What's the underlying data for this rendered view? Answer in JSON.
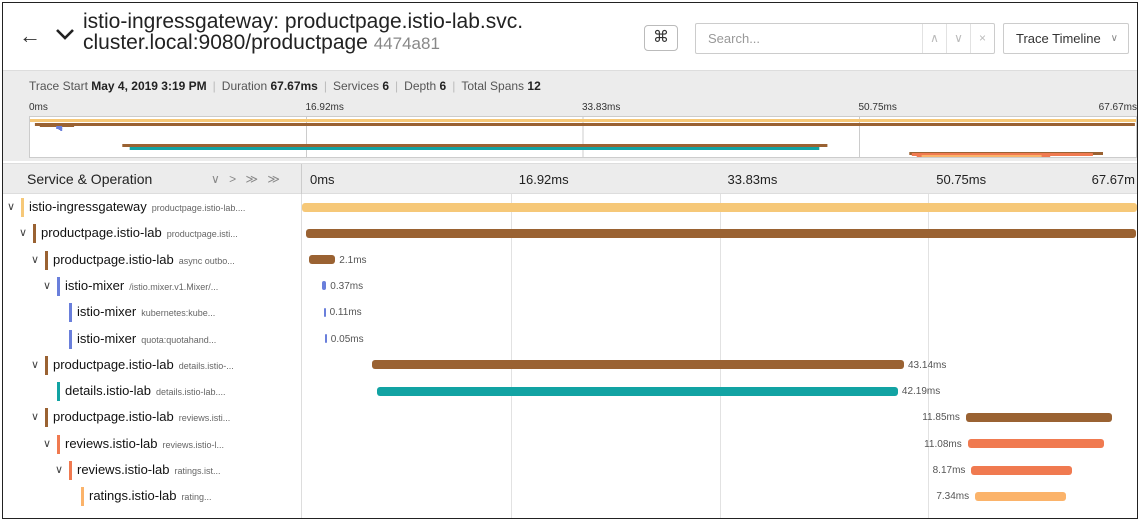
{
  "header": {
    "back_icon": "arrow-left-icon",
    "collapse_icon": "chevron-down-icon",
    "title_line1": "istio-ingressgateway: productpage.istio-lab.svc.",
    "title_line2": "cluster.local:9080/productpage",
    "trace_id": "4474a81",
    "keyboard_shortcut_icon": "⌘",
    "search": {
      "placeholder": "Search...",
      "value": ""
    },
    "search_prev_icon": "^",
    "search_next_icon": "v",
    "search_clear_icon": "×",
    "view_select": {
      "label": "Trace Timeline",
      "dropdown_icon": "chevron-down-icon"
    }
  },
  "meta": {
    "trace_start_label": "Trace Start",
    "trace_start_value": "May 4, 2019 3:19 PM",
    "duration_label": "Duration",
    "duration_value": "67.67ms",
    "services_label": "Services",
    "services_value": "6",
    "depth_label": "Depth",
    "depth_value": "6",
    "total_spans_label": "Total Spans",
    "total_spans_value": "12"
  },
  "minimap": {
    "ticks": [
      "0ms",
      "16.92ms",
      "33.83ms",
      "50.75ms",
      "67.67ms"
    ]
  },
  "column_header": {
    "title": "Service & Operation",
    "controls": "∨ > ≫ ≫",
    "ticks": [
      "0ms",
      "16.92ms",
      "33.83ms",
      "50.75ms",
      "67.67m"
    ]
  },
  "trace_total_ms": 67.67,
  "colors": {
    "istio-ingressgateway": "#f6c878",
    "productpage.istio-lab": "#9a6232",
    "istio-mixer": "#6a7fdb",
    "details.istio-lab": "#12a3a3",
    "reviews.istio-lab": "#f07a50",
    "ratings.istio-lab": "#fbb36a"
  },
  "spans": [
    {
      "service": "istio-ingressgateway",
      "operation": "productpage.istio-lab....",
      "depth": 0,
      "toggle": "∨",
      "start_ms": 0,
      "duration_ms": 67.67,
      "duration_label": ""
    },
    {
      "service": "productpage.istio-lab",
      "operation": "productpage.isti...",
      "depth": 1,
      "toggle": "∨",
      "start_ms": 0.3,
      "duration_ms": 67.3,
      "duration_label": ""
    },
    {
      "service": "productpage.istio-lab",
      "operation": "async outbo...",
      "depth": 2,
      "toggle": "∨",
      "start_ms": 0.6,
      "duration_ms": 2.1,
      "duration_label": "2.1ms"
    },
    {
      "service": "istio-mixer",
      "operation": "/istio.mixer.v1.Mixer/...",
      "depth": 3,
      "toggle": "∨",
      "start_ms": 1.6,
      "duration_ms": 0.37,
      "duration_label": "0.37ms"
    },
    {
      "service": "istio-mixer",
      "operation": "kubernetes:kube...",
      "depth": 4,
      "toggle": "",
      "start_ms": 1.75,
      "duration_ms": 0.11,
      "duration_label": "0.11ms"
    },
    {
      "service": "istio-mixer",
      "operation": "quota:quotahand...",
      "depth": 4,
      "toggle": "",
      "start_ms": 1.85,
      "duration_ms": 0.05,
      "duration_label": "0.05ms"
    },
    {
      "service": "productpage.istio-lab",
      "operation": "details.istio-...",
      "depth": 2,
      "toggle": "∨",
      "start_ms": 5.65,
      "duration_ms": 43.14,
      "duration_label": "43.14ms"
    },
    {
      "service": "details.istio-lab",
      "operation": "details.istio-lab....",
      "depth": 3,
      "toggle": "",
      "start_ms": 6.1,
      "duration_ms": 42.19,
      "duration_label": "42.19ms"
    },
    {
      "service": "productpage.istio-lab",
      "operation": "reviews.isti...",
      "depth": 2,
      "toggle": "∨",
      "start_ms": 53.8,
      "duration_ms": 11.85,
      "duration_label": "11.85ms"
    },
    {
      "service": "reviews.istio-lab",
      "operation": "reviews.istio-l...",
      "depth": 3,
      "toggle": "∨",
      "start_ms": 53.95,
      "duration_ms": 11.08,
      "duration_label": "11.08ms"
    },
    {
      "service": "reviews.istio-lab",
      "operation": "ratings.ist...",
      "depth": 4,
      "toggle": "∨",
      "start_ms": 54.25,
      "duration_ms": 8.17,
      "duration_label": "8.17ms"
    },
    {
      "service": "ratings.istio-lab",
      "operation": "rating...",
      "depth": 5,
      "toggle": "",
      "start_ms": 54.55,
      "duration_ms": 7.34,
      "duration_label": "7.34ms"
    }
  ]
}
